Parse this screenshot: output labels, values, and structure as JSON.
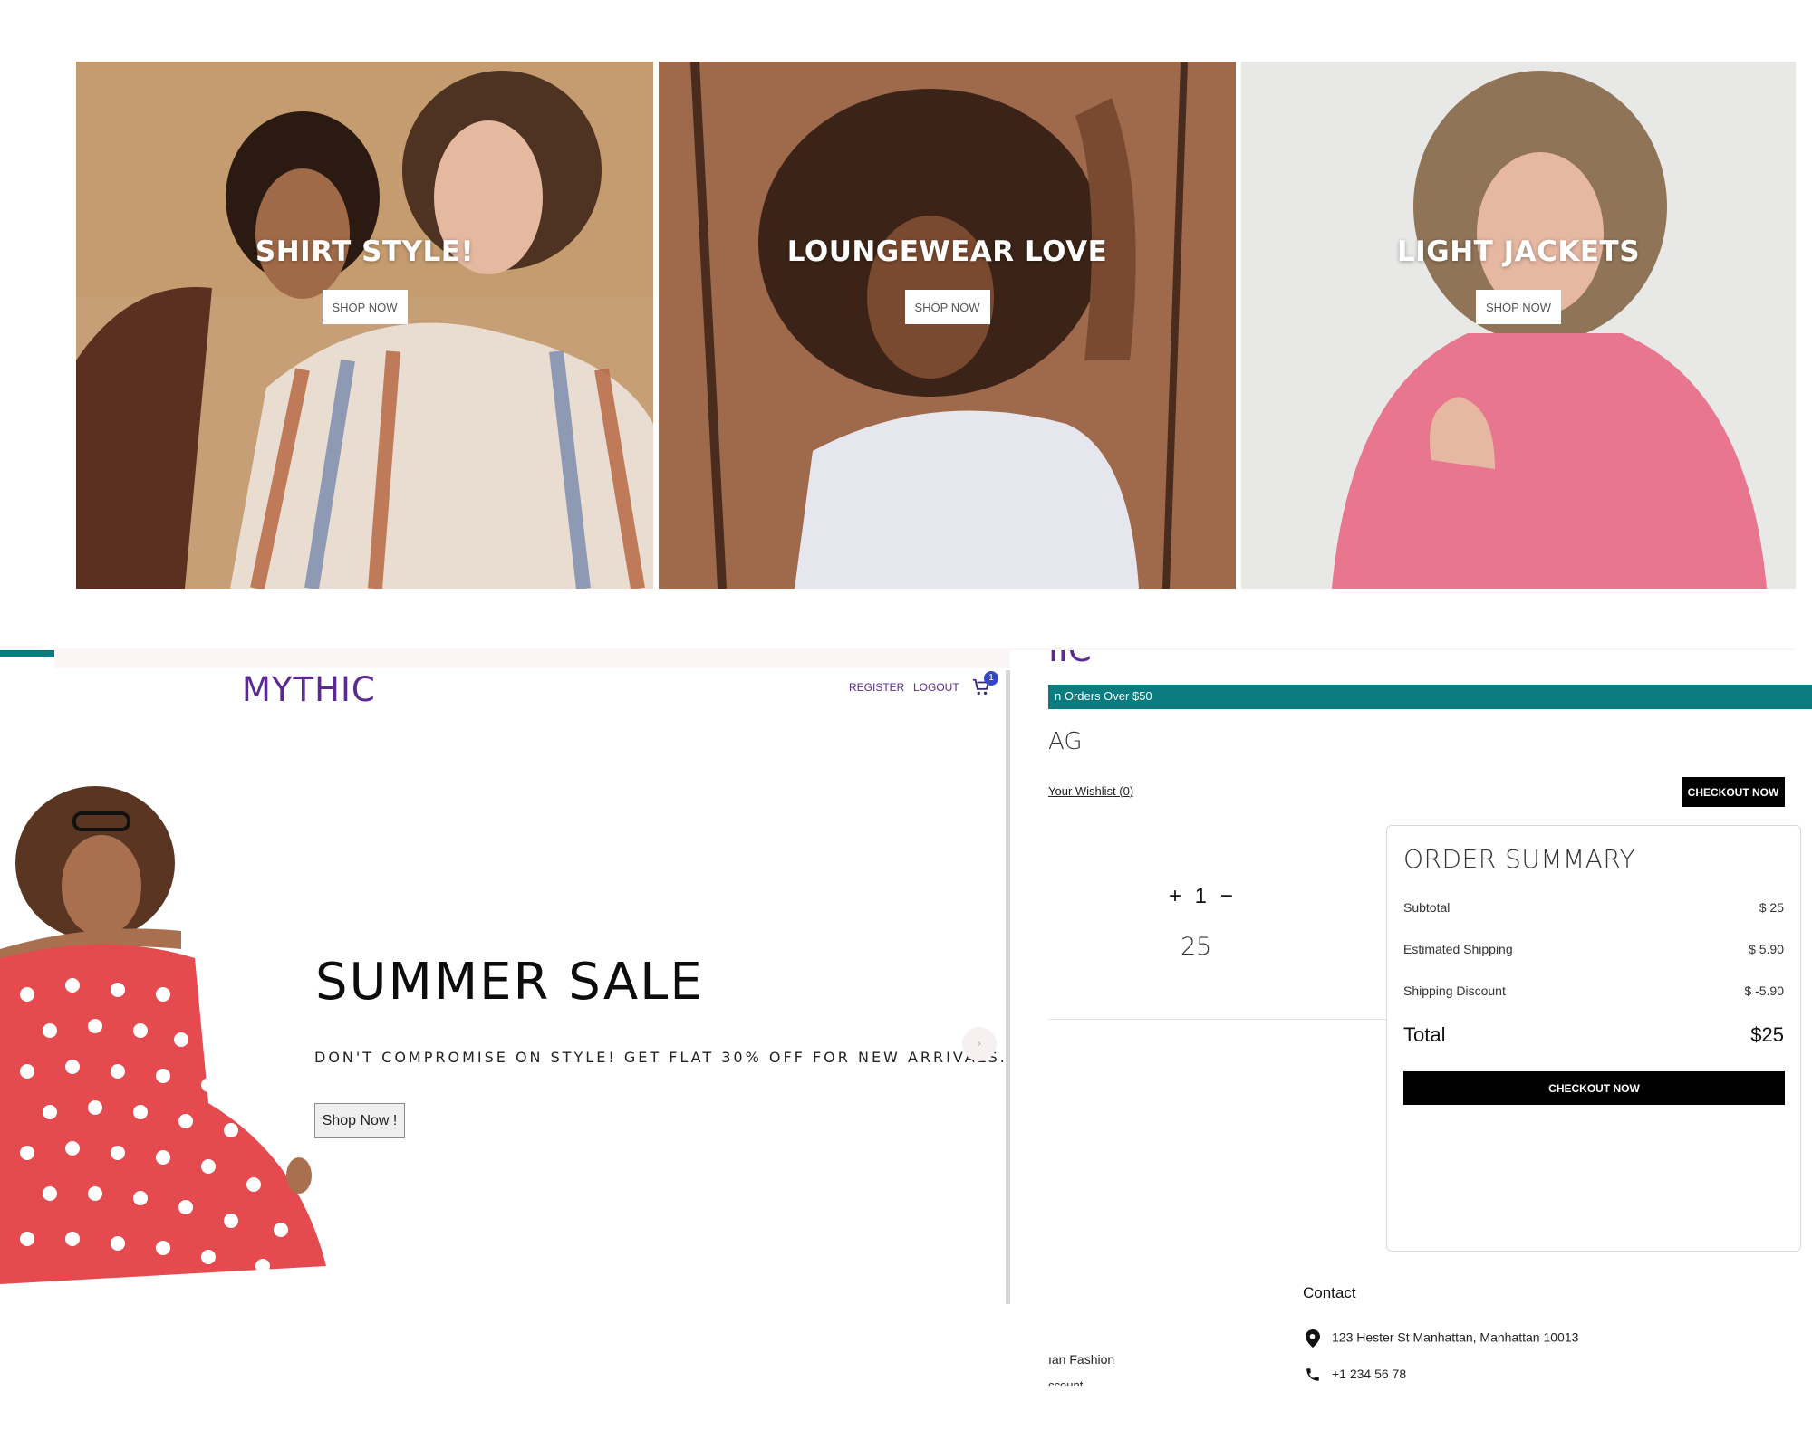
{
  "colors": {
    "brand_purple": "#5a2a91",
    "teal": "#0a7c80",
    "black": "#000000",
    "badge_blue": "#3547c7"
  },
  "collage": {
    "tiles": [
      {
        "title": "SHIRT STYLE!",
        "button": "SHOP NOW"
      },
      {
        "title": "LOUNGEWEAR LOVE",
        "button": "SHOP NOW"
      },
      {
        "title": "LIGHT JACKETS",
        "button": "SHOP NOW"
      }
    ]
  },
  "home": {
    "logo": "MYTHIC",
    "nav": {
      "register": "REGISTER",
      "logout": "LOGOUT",
      "cart_icon": "cart-icon",
      "cart_count": "1"
    },
    "hero": {
      "title": "SUMMER SALE",
      "subtitle": "DON'T COMPROMISE ON STYLE! GET FLAT 30% OFF FOR NEW ARRIVALS.",
      "button": "Shop Now !",
      "next_arrow": "›"
    }
  },
  "cart": {
    "logo_fragment": "IIC",
    "banner": "n Orders Over $50",
    "title_fragment": "AG",
    "wishlist": "Your Wishlist (0)",
    "checkout_top": "CHECKOUT NOW",
    "item": {
      "quantity_controls": "+ 1 −",
      "price": "25"
    },
    "summary": {
      "title": "ORDER SUMMARY",
      "rows": [
        {
          "label": "Subtotal",
          "value": "$ 25"
        },
        {
          "label": "Estimated Shipping",
          "value": "$ 5.90"
        },
        {
          "label": "Shipping Discount",
          "value": "$ -5.90"
        }
      ],
      "total_label": "Total",
      "total_value": "$25",
      "checkout": "CHECKOUT NOW"
    },
    "footer": {
      "contact_heading": "Contact",
      "address": "123 Hester St Manhattan, Manhattan 10013",
      "phone": "+1 234 56 78",
      "left_fragment_1": "ıan Fashion",
      "left_fragment_2": "ccount"
    }
  }
}
